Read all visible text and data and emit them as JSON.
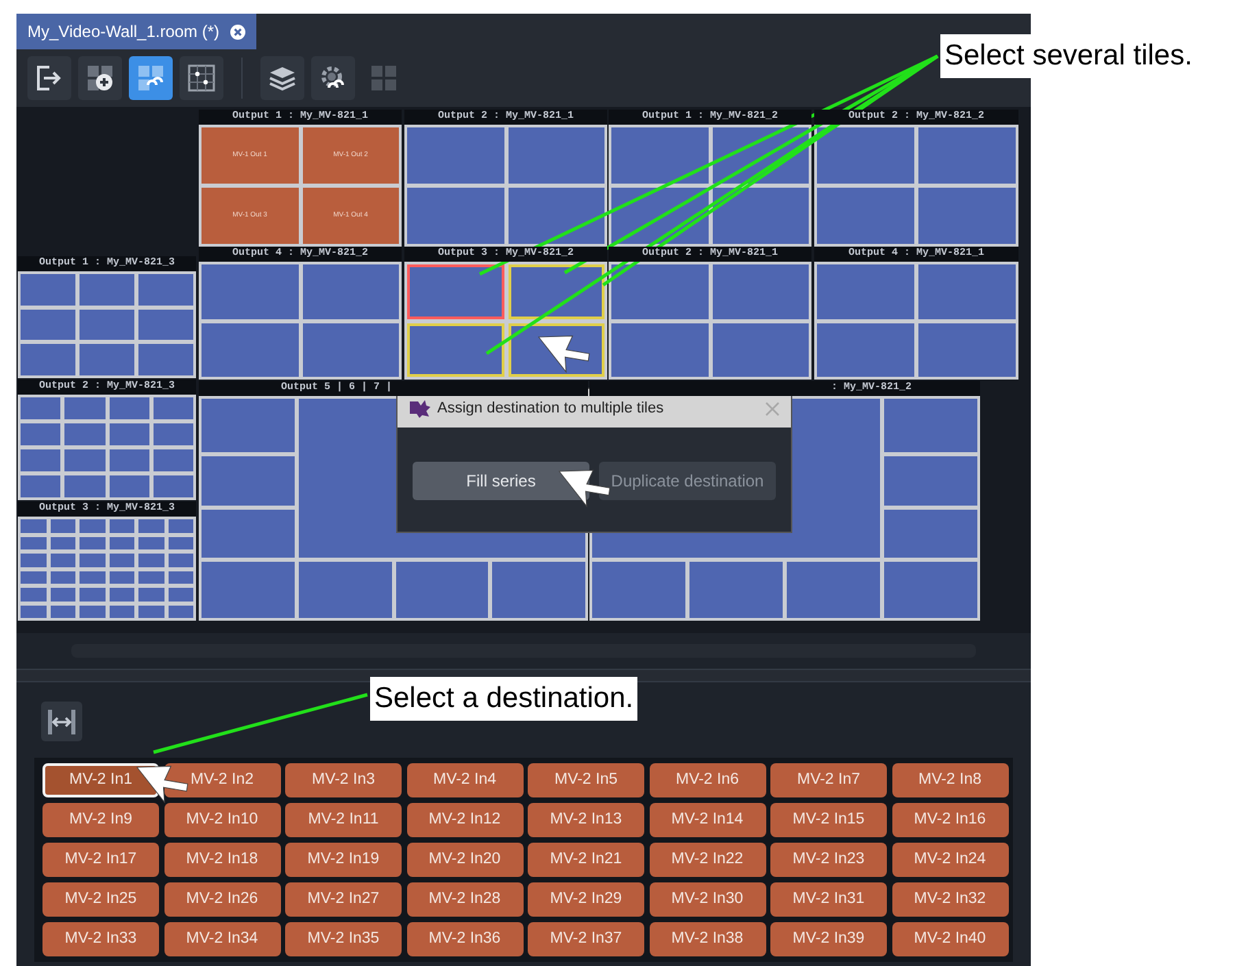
{
  "tab": {
    "title": "My_Video-Wall_1.room (*)",
    "selected": true
  },
  "toolbar": [
    {
      "kind": "exit",
      "selected": false,
      "disabled": false
    },
    {
      "kind": "add",
      "selected": false,
      "disabled": false
    },
    {
      "kind": "assign",
      "selected": true,
      "disabled": false
    },
    {
      "kind": "points",
      "selected": false,
      "disabled": false
    },
    {
      "kind": "layers",
      "selected": false,
      "disabled": false
    },
    {
      "kind": "gear",
      "selected": false,
      "disabled": false
    },
    {
      "kind": "grid",
      "selected": false,
      "disabled": true
    }
  ],
  "outputs": [
    {
      "label": "Output 1 : My_MV-821_1",
      "kind": "grid",
      "rows": [
        [
          {
            "kind": "assigned",
            "label": "MV-1 Out 1"
          },
          {
            "kind": "assigned",
            "label": "MV-1 Out 2"
          }
        ],
        [
          {
            "kind": "assigned",
            "label": "MV-1 Out 3"
          },
          {
            "kind": "assigned",
            "label": "MV-1 Out 4"
          }
        ]
      ]
    },
    {
      "label": "Output 2 : My_MV-821_1",
      "kind": "grid",
      "rows": [
        [
          {
            "kind": "empty"
          },
          {
            "kind": "empty"
          }
        ],
        [
          {
            "kind": "empty"
          },
          {
            "kind": "empty"
          }
        ]
      ]
    },
    {
      "label": "Output 1 : My_MV-821_2",
      "kind": "grid",
      "rows": [
        [
          {
            "kind": "empty"
          },
          {
            "kind": "empty"
          }
        ],
        [
          {
            "kind": "empty"
          },
          {
            "kind": "empty"
          }
        ]
      ]
    },
    {
      "label": "Output 2 : My_MV-821_2",
      "kind": "grid",
      "rows": [
        [
          {
            "kind": "empty"
          },
          {
            "kind": "empty"
          }
        ],
        [
          {
            "kind": "empty"
          },
          {
            "kind": "empty"
          }
        ]
      ]
    },
    {
      "label": "Output 1 : My_MV-821_3",
      "kind": "grid",
      "rows": [
        [
          {
            "kind": "empty"
          },
          {
            "kind": "empty"
          },
          {
            "kind": "empty"
          }
        ],
        [
          {
            "kind": "empty"
          },
          {
            "kind": "empty"
          },
          {
            "kind": "empty"
          }
        ],
        [
          {
            "kind": "empty"
          },
          {
            "kind": "empty"
          },
          {
            "kind": "empty"
          }
        ]
      ]
    },
    {
      "label": "Output 4 : My_MV-821_2",
      "kind": "grid",
      "rows": [
        [
          {
            "kind": "empty"
          },
          {
            "kind": "empty"
          }
        ],
        [
          {
            "kind": "empty"
          },
          {
            "kind": "empty"
          }
        ]
      ]
    },
    {
      "label": "Output 3 : My_MV-821_2",
      "kind": "grid",
      "rows": [
        [
          {
            "kind": "current"
          },
          {
            "kind": "selected"
          }
        ],
        [
          {
            "kind": "selected"
          },
          {
            "kind": "selected"
          }
        ]
      ]
    },
    {
      "label": "Output 2 : My_MV-821_1",
      "kind": "grid",
      "rows": [
        [
          {
            "kind": "empty"
          },
          {
            "kind": "empty"
          }
        ],
        [
          {
            "kind": "empty"
          },
          {
            "kind": "empty"
          }
        ]
      ]
    },
    {
      "label": "Output 4 : My_MV-821_1",
      "kind": "grid",
      "rows": [
        [
          {
            "kind": "empty"
          },
          {
            "kind": "empty"
          }
        ],
        [
          {
            "kind": "empty"
          },
          {
            "kind": "empty"
          }
        ]
      ]
    },
    {
      "label": "Output 2 : My_MV-821_3",
      "kind": "grid",
      "rows": [
        [
          {
            "kind": "empty"
          },
          {
            "kind": "empty"
          },
          {
            "kind": "empty"
          },
          {
            "kind": "empty"
          }
        ],
        [
          {
            "kind": "empty"
          },
          {
            "kind": "empty"
          },
          {
            "kind": "empty"
          },
          {
            "kind": "empty"
          }
        ],
        [
          {
            "kind": "empty"
          },
          {
            "kind": "empty"
          },
          {
            "kind": "empty"
          },
          {
            "kind": "empty"
          }
        ],
        [
          {
            "kind": "empty"
          },
          {
            "kind": "empty"
          },
          {
            "kind": "empty"
          },
          {
            "kind": "empty"
          }
        ]
      ]
    },
    {
      "label": "Output 5 | 6 | 7 |",
      "kind": "split-left",
      "tiles": [
        {
          "kind": "empty"
        },
        {
          "kind": "empty"
        },
        {
          "kind": "empty"
        },
        {
          "kind": "empty"
        },
        {
          "kind": "empty"
        },
        {
          "kind": "empty"
        },
        {
          "kind": "empty"
        },
        {
          "kind": "empty"
        }
      ]
    },
    {
      "label": ": My_MV-821_2",
      "kind": "split-right",
      "tiles": [
        {
          "kind": "empty"
        },
        {
          "kind": "empty"
        },
        {
          "kind": "empty"
        },
        {
          "kind": "empty"
        },
        {
          "kind": "empty"
        },
        {
          "kind": "empty"
        },
        {
          "kind": "empty"
        },
        {
          "kind": "empty"
        }
      ]
    },
    {
      "label": "Output 3 : My_MV-821_3",
      "kind": "grid",
      "rows": [
        [
          {
            "kind": "empty"
          },
          {
            "kind": "empty"
          },
          {
            "kind": "empty"
          },
          {
            "kind": "empty"
          },
          {
            "kind": "empty"
          },
          {
            "kind": "empty"
          }
        ],
        [
          {
            "kind": "empty"
          },
          {
            "kind": "empty"
          },
          {
            "kind": "empty"
          },
          {
            "kind": "empty"
          },
          {
            "kind": "empty"
          },
          {
            "kind": "empty"
          }
        ],
        [
          {
            "kind": "empty"
          },
          {
            "kind": "empty"
          },
          {
            "kind": "empty"
          },
          {
            "kind": "empty"
          },
          {
            "kind": "empty"
          },
          {
            "kind": "empty"
          }
        ],
        [
          {
            "kind": "empty"
          },
          {
            "kind": "empty"
          },
          {
            "kind": "empty"
          },
          {
            "kind": "empty"
          },
          {
            "kind": "empty"
          },
          {
            "kind": "empty"
          }
        ],
        [
          {
            "kind": "empty"
          },
          {
            "kind": "empty"
          },
          {
            "kind": "empty"
          },
          {
            "kind": "empty"
          },
          {
            "kind": "empty"
          },
          {
            "kind": "empty"
          }
        ],
        [
          {
            "kind": "empty"
          },
          {
            "kind": "empty"
          },
          {
            "kind": "empty"
          },
          {
            "kind": "empty"
          },
          {
            "kind": "empty"
          },
          {
            "kind": "empty"
          }
        ]
      ]
    }
  ],
  "dialog": {
    "title": "Assign destination to multiple tiles",
    "buttons": [
      {
        "label": "Fill series",
        "hovered": true
      },
      {
        "label": "Duplicate destination",
        "hovered": false
      }
    ]
  },
  "sources": [
    {
      "label": "MV-2 In1",
      "selected": true
    },
    {
      "label": "MV-2 In2",
      "selected": false
    },
    {
      "label": "MV-2 In3",
      "selected": false
    },
    {
      "label": "MV-2 In4",
      "selected": false
    },
    {
      "label": "MV-2 In5",
      "selected": false
    },
    {
      "label": "MV-2 In6",
      "selected": false
    },
    {
      "label": "MV-2 In7",
      "selected": false
    },
    {
      "label": "MV-2 In8",
      "selected": false
    },
    {
      "label": "MV-2 In9",
      "selected": false
    },
    {
      "label": "MV-2 In10",
      "selected": false
    },
    {
      "label": "MV-2 In11",
      "selected": false
    },
    {
      "label": "MV-2 In12",
      "selected": false
    },
    {
      "label": "MV-2 In13",
      "selected": false
    },
    {
      "label": "MV-2 In14",
      "selected": false
    },
    {
      "label": "MV-2 In15",
      "selected": false
    },
    {
      "label": "MV-2 In16",
      "selected": false
    },
    {
      "label": "MV-2 In17",
      "selected": false
    },
    {
      "label": "MV-2 In18",
      "selected": false
    },
    {
      "label": "MV-2 In19",
      "selected": false
    },
    {
      "label": "MV-2 In20",
      "selected": false
    },
    {
      "label": "MV-2 In21",
      "selected": false
    },
    {
      "label": "MV-2 In22",
      "selected": false
    },
    {
      "label": "MV-2 In23",
      "selected": false
    },
    {
      "label": "MV-2 In24",
      "selected": false
    },
    {
      "label": "MV-2 In25",
      "selected": false
    },
    {
      "label": "MV-2 In26",
      "selected": false
    },
    {
      "label": "MV-2 In27",
      "selected": false
    },
    {
      "label": "MV-2 In28",
      "selected": false
    },
    {
      "label": "MV-2 In29",
      "selected": false
    },
    {
      "label": "MV-2 In30",
      "selected": false
    },
    {
      "label": "MV-2 In31",
      "selected": false
    },
    {
      "label": "MV-2 In32",
      "selected": false
    },
    {
      "label": "MV-2 In33",
      "selected": false
    },
    {
      "label": "MV-2 In34",
      "selected": false
    },
    {
      "label": "MV-2 In35",
      "selected": false
    },
    {
      "label": "MV-2 In36",
      "selected": false
    },
    {
      "label": "MV-2 In37",
      "selected": false
    },
    {
      "label": "MV-2 In38",
      "selected": false
    },
    {
      "label": "MV-2 In39",
      "selected": false
    },
    {
      "label": "MV-2 In40",
      "selected": false
    }
  ],
  "callouts": [
    {
      "text": "Select several tiles."
    },
    {
      "text": "Select a destination."
    }
  ]
}
